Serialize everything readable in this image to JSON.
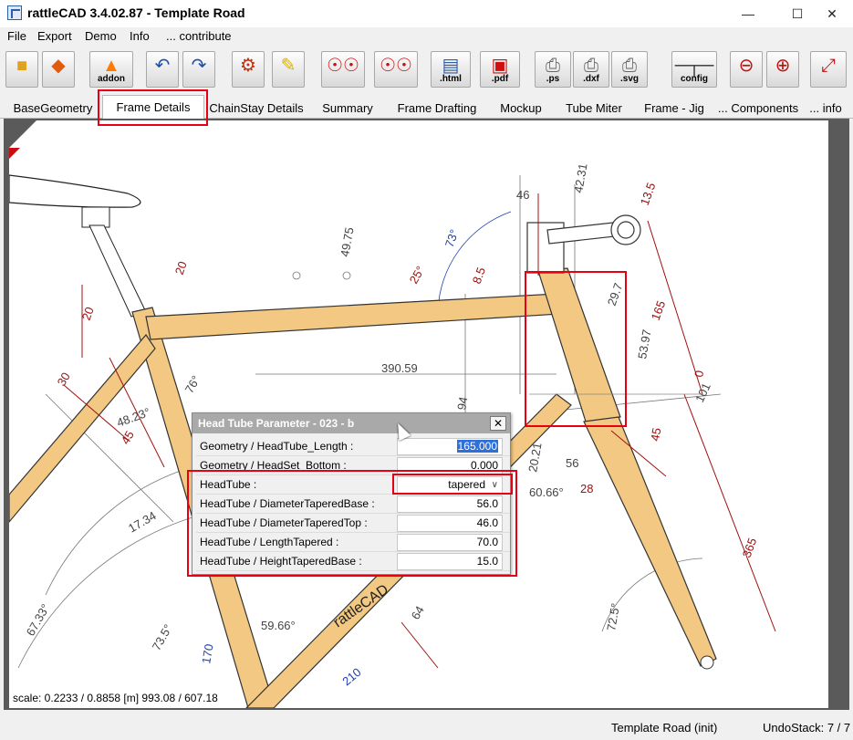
{
  "window": {
    "title": "rattleCAD  3.4.02.87 - Template Road",
    "min_icon": "minimize-icon",
    "max_icon": "maximize-icon",
    "close_icon": "close-icon"
  },
  "menu": [
    "File",
    "Export",
    "Demo",
    "Info",
    "... contribute"
  ],
  "toolbar": {
    "addon_label": "addon",
    "html_label": ".html",
    "pdf_label": ".pdf",
    "ps_label": ".ps",
    "dxf_label": ".dxf",
    "svg_label": ".svg",
    "config_label": "config"
  },
  "tabs": [
    "BaseGeometry",
    "Frame Details",
    "ChainStay Details",
    "Summary",
    "Frame Drafting",
    "Mockup",
    "Tube Miter",
    "Frame - Jig",
    "... Components",
    "... info"
  ],
  "active_tab": "Frame Details",
  "canvas": {
    "scale_text": "scale: 0.2233 / 0.8858  [m]  993.08 / 607.18",
    "dimensions": [
      "390.59",
      "46",
      "42.31",
      "13.5",
      "165",
      "53.97",
      "101",
      "45",
      "365",
      "28",
      "56",
      "60.66°",
      "20.21",
      "94",
      "49.75",
      "25°",
      "8.5",
      "73°",
      "76°",
      "48.23°",
      "45",
      "30",
      "20",
      "20",
      "17.34",
      "67.33°",
      "73.5°",
      "64",
      "59.66°",
      "170",
      "210",
      "72.5°",
      "0",
      "29.7"
    ],
    "brand_text": "rattleCAD"
  },
  "dialog": {
    "title": "Head Tube Parameter - 023 - b",
    "rows": [
      {
        "label": "Geometry / HeadTube_Length  :",
        "value": "165.000"
      },
      {
        "label": "Geometry / HeadSet_Bottom  :",
        "value": "0.000"
      },
      {
        "label": "HeadTube  :",
        "value": "tapered"
      },
      {
        "label": "HeadTube / DiameterTaperedBase  :",
        "value": "56.0"
      },
      {
        "label": "HeadTube / DiameterTaperedTop  :",
        "value": "46.0"
      },
      {
        "label": "HeadTube / LengthTapered  :",
        "value": "70.0"
      },
      {
        "label": "HeadTube / HeightTaperedBase  :",
        "value": "15.0"
      }
    ]
  },
  "status": {
    "left": "Template Road (init)",
    "right": "UndoStack:  7 / 7"
  }
}
